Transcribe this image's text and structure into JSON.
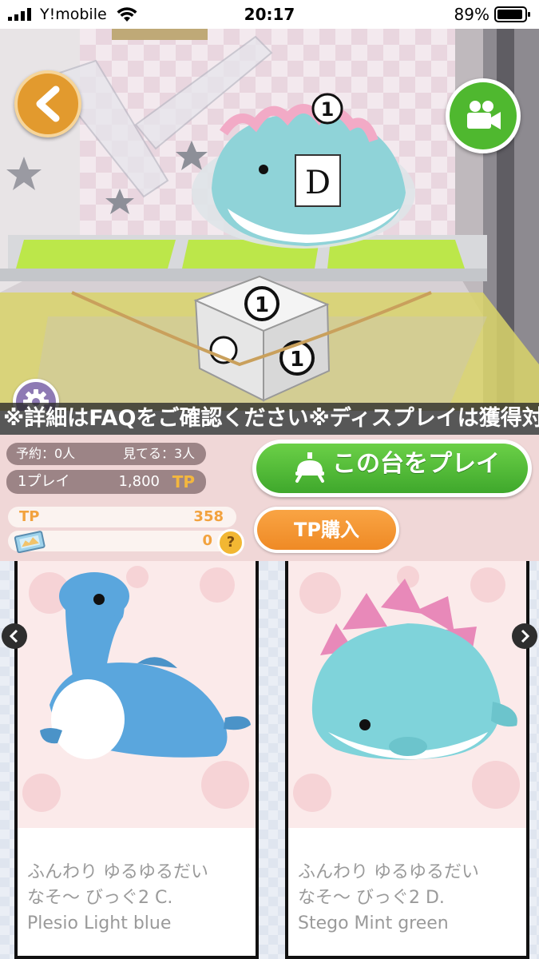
{
  "status_bar": {
    "carrier": "Y!mobile",
    "time": "20:17",
    "battery": "89%"
  },
  "camera": {
    "prize_box_label": "D",
    "box_number": "①"
  },
  "marquee": {
    "text": "※詳細はFAQをご確認ください※ディスプレイは獲得対象"
  },
  "panel": {
    "reservations": "予約：0人",
    "watching": "見てる：3人",
    "price_label": "1プレイ",
    "price_value": "1,800",
    "price_unit": "TP",
    "play_button": "この台をプレイ",
    "tp_label": "TP",
    "tp_value": "358",
    "ticket_value": "0",
    "help": "?",
    "buy_button": "TP購入"
  },
  "prizes": [
    {
      "line1": "ふんわり ゆるゆるだい",
      "line2": "なそ～ びっぐ2 C.",
      "line3": "Plesio Light blue"
    },
    {
      "line1": "ふんわり ゆるゆるだい",
      "line2": "なそ～ びっぐ2 D.",
      "line3": "Stego Mint green"
    }
  ],
  "colors": {
    "play_green": "#4fb82f",
    "accent_orange": "#ef8a25",
    "panel_pink": "#f0d7d7",
    "tp_orange": "#f2a23e"
  },
  "icons": {
    "back": "chevron-left-icon",
    "video": "video-camera-icon",
    "settings": "gear-icon",
    "play": "crane-claw-icon",
    "ticket": "ticket-icon",
    "help": "question-icon",
    "carousel_prev": "chevron-left-icon",
    "carousel_next": "chevron-right-icon"
  }
}
